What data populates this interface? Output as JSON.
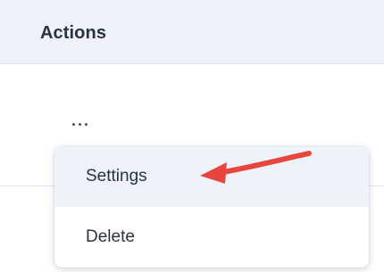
{
  "table": {
    "header_label": "Actions"
  },
  "row": {
    "more_icon": "ellipsis-horizontal-icon"
  },
  "dropdown": {
    "items": [
      {
        "label": "Settings",
        "highlighted": true
      },
      {
        "label": "Delete",
        "highlighted": false
      }
    ]
  },
  "annotation": {
    "arrow_color": "#e8453c"
  },
  "colors": {
    "header_bg": "#eef2fb",
    "text": "#2b3140",
    "divider": "#dde4f0"
  }
}
